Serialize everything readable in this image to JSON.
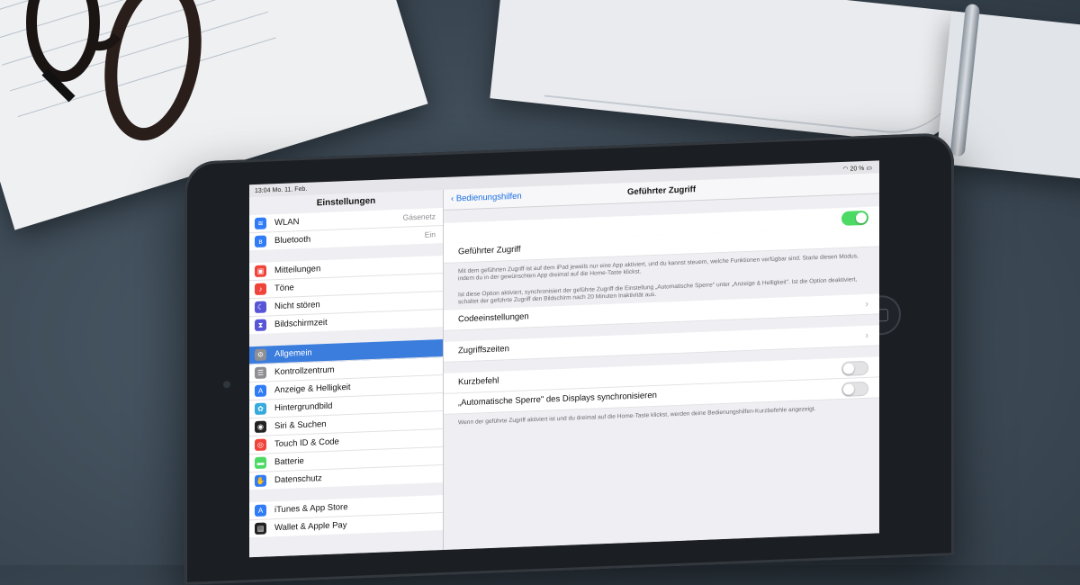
{
  "status_bar": {
    "time": "13:04",
    "date": "Mo. 11. Feb.",
    "battery": "20 %"
  },
  "sidebar": {
    "title": "Einstellungen",
    "group1": [
      {
        "label": "WLAN",
        "value": "Gäsenetz",
        "icon": "wifi-icon",
        "color": "#2f7cf6"
      },
      {
        "label": "Bluetooth",
        "value": "Ein",
        "icon": "bluetooth-icon",
        "color": "#2f7cf6"
      }
    ],
    "group2": [
      {
        "label": "Mitteilungen",
        "icon": "notifications-icon",
        "color": "#f0433a"
      },
      {
        "label": "Töne",
        "icon": "sound-icon",
        "color": "#f0433a"
      },
      {
        "label": "Nicht stören",
        "icon": "moon-icon",
        "color": "#5856d6"
      },
      {
        "label": "Bildschirmzeit",
        "icon": "hourglass-icon",
        "color": "#5856d6"
      }
    ],
    "group3": [
      {
        "label": "Allgemein",
        "icon": "gear-icon",
        "color": "#8e8e93",
        "selected": true
      },
      {
        "label": "Kontrollzentrum",
        "icon": "control-center-icon",
        "color": "#8e8e93"
      },
      {
        "label": "Anzeige & Helligkeit",
        "icon": "display-icon",
        "color": "#2f7cf6"
      },
      {
        "label": "Hintergrundbild",
        "icon": "wallpaper-icon",
        "color": "#35aadc"
      },
      {
        "label": "Siri & Suchen",
        "icon": "siri-icon",
        "color": "#222222"
      },
      {
        "label": "Touch ID & Code",
        "icon": "fingerprint-icon",
        "color": "#f0433a"
      },
      {
        "label": "Batterie",
        "icon": "battery-icon",
        "color": "#4cd964"
      },
      {
        "label": "Datenschutz",
        "icon": "hand-icon",
        "color": "#2f7cf6"
      }
    ],
    "group4": [
      {
        "label": "iTunes & App Store",
        "icon": "app-store-icon",
        "color": "#2f7cf6"
      },
      {
        "label": "Wallet & Apple Pay",
        "icon": "wallet-icon",
        "color": "#222222"
      }
    ]
  },
  "detail": {
    "back_label": "Bedienungshilfen",
    "title": "Geführter Zugriff",
    "main_toggle_label": "Geführter Zugriff",
    "main_toggle_on": true,
    "note1": "Mit dem geführten Zugriff ist auf dem iPad jeweils nur eine App aktiviert, und du kannst steuern, welche Funktionen verfügbar sind. Starte diesen Modus, indem du in der gewünschten App dreimal auf die Home-Taste klickst.",
    "note2": "Ist diese Option aktiviert, synchronisiert der geführte Zugriff die Einstellung „Automatische Sperre\" unter „Anzeige & Helligkeit\". Ist die Option deaktiviert, schaltet der geführte Zugriff den Bildschirm nach 20 Minuten Inaktivität aus.",
    "code_settings": "Codeeinstellungen",
    "access_times": "Zugriffszeiten",
    "shortcut": "Kurzbefehl",
    "shortcut_on": false,
    "autolock_sync": "„Automatische Sperre\" des Displays synchronisieren",
    "autolock_on": false,
    "note3": "Wenn der geführte Zugriff aktiviert ist und du dreimal auf die Home-Taste klickst, werden deine Bedienungshilfen-Kurzbefehle angezeigt."
  }
}
